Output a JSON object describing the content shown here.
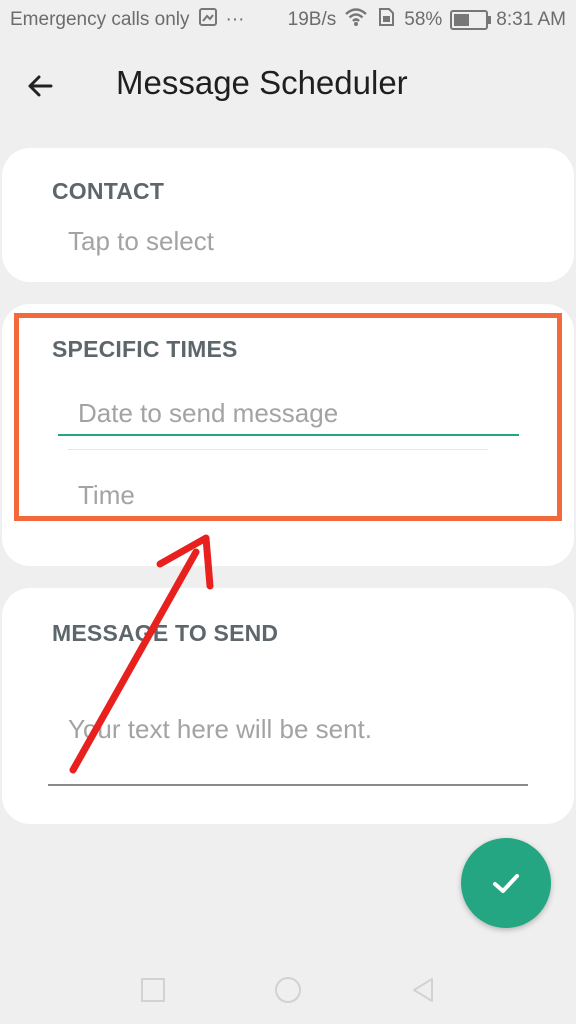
{
  "status_bar": {
    "carrier": "Emergency calls only",
    "dots": "···",
    "speed": "19B/s",
    "battery_pct": "58%",
    "battery_level": 0.58,
    "time": "8:31 AM"
  },
  "header": {
    "title": "Message Scheduler"
  },
  "contact": {
    "label": "CONTACT",
    "placeholder": "Tap to select"
  },
  "specific_times": {
    "label": "SPECIFIC TIMES",
    "date_placeholder": "Date to send message",
    "time_placeholder": "Time"
  },
  "message": {
    "label": "MESSAGE TO SEND",
    "placeholder": "Your text here will be sent."
  },
  "colors": {
    "accent": "#24a682",
    "annotation": "#f26a3c",
    "arrow": "#e8211f"
  }
}
